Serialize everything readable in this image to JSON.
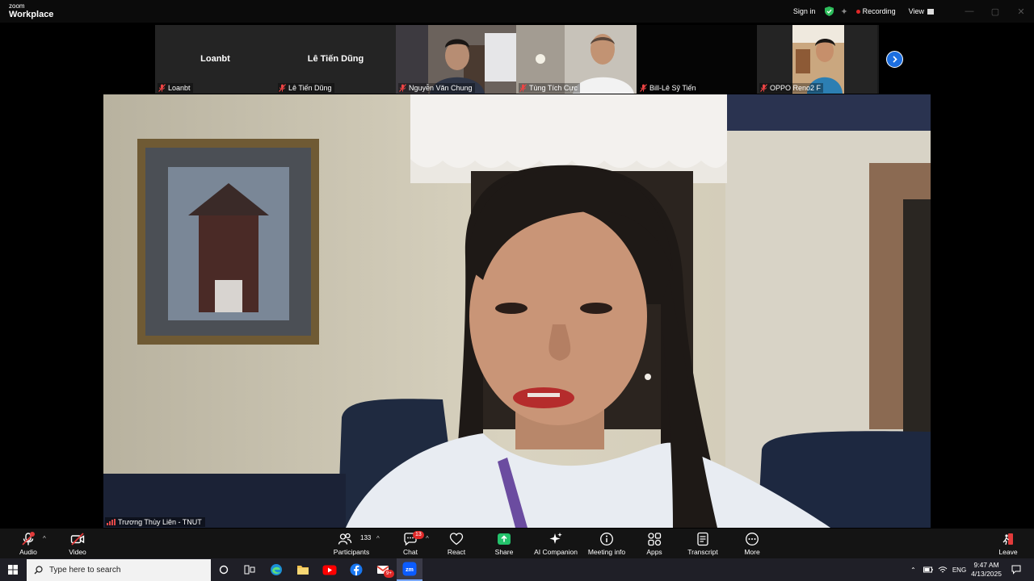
{
  "titlebar": {
    "brand_small": "zoom",
    "brand_large": "Workplace",
    "sign_in": "Sign in",
    "recording": "Recording",
    "view": "View"
  },
  "thumbnails": [
    {
      "name": "Loanbt",
      "big_name": "Loanbt",
      "video": false
    },
    {
      "name": "Lê Tiến Dũng",
      "big_name": "Lê Tiến Dũng",
      "video": false
    },
    {
      "name": "Nguyễn Văn Chung",
      "video": true
    },
    {
      "name": "Tùng Tích Cực",
      "video": true
    },
    {
      "name": "Bill-Lê Sỹ Tiến",
      "video": false
    },
    {
      "name": "OPPO Reno2 F",
      "video": true
    }
  ],
  "main_speaker": {
    "name": "Trương Thùy Liên - TNUT"
  },
  "toolbar": {
    "audio": "Audio",
    "video": "Video",
    "participants": "Participants",
    "participants_count": "133",
    "chat": "Chat",
    "chat_badge": "13",
    "react": "React",
    "share": "Share",
    "ai_companion": "AI Companion",
    "meeting_info": "Meeting info",
    "apps": "Apps",
    "transcript": "Transcript",
    "more": "More",
    "leave": "Leave"
  },
  "taskbar": {
    "search_placeholder": "Type here to search",
    "lang": "ENG",
    "time": "9:47 AM",
    "date": "4/13/2025",
    "gmail_badge": "9+"
  },
  "colors": {
    "accent_blue": "#1d6fe0",
    "record_red": "#e02828",
    "share_green": "#23c26b"
  }
}
